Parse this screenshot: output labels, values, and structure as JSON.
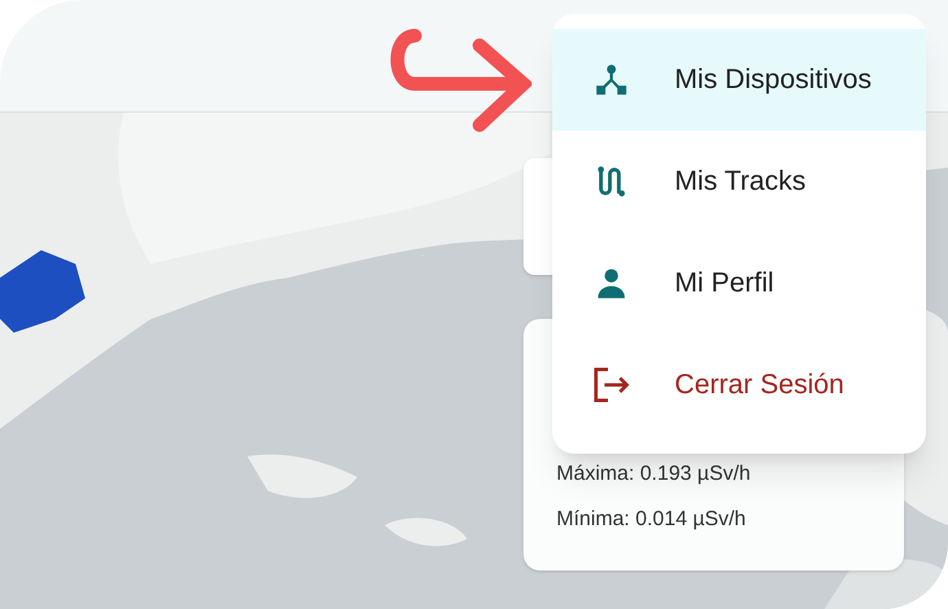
{
  "stats_card": {
    "lines": [
      "Máxima: 0.193 µSv/h",
      "Mínima: 0.014 µSv/h"
    ]
  },
  "menu": {
    "items": [
      {
        "label": "Mis Dispositivos",
        "kind": "devices",
        "selected": true
      },
      {
        "label": "Mis Tracks",
        "kind": "tracks",
        "selected": false
      },
      {
        "label": "Mi Perfil",
        "kind": "profile",
        "selected": false
      },
      {
        "label": "Cerrar Sesión",
        "kind": "logout",
        "selected": false
      }
    ]
  }
}
